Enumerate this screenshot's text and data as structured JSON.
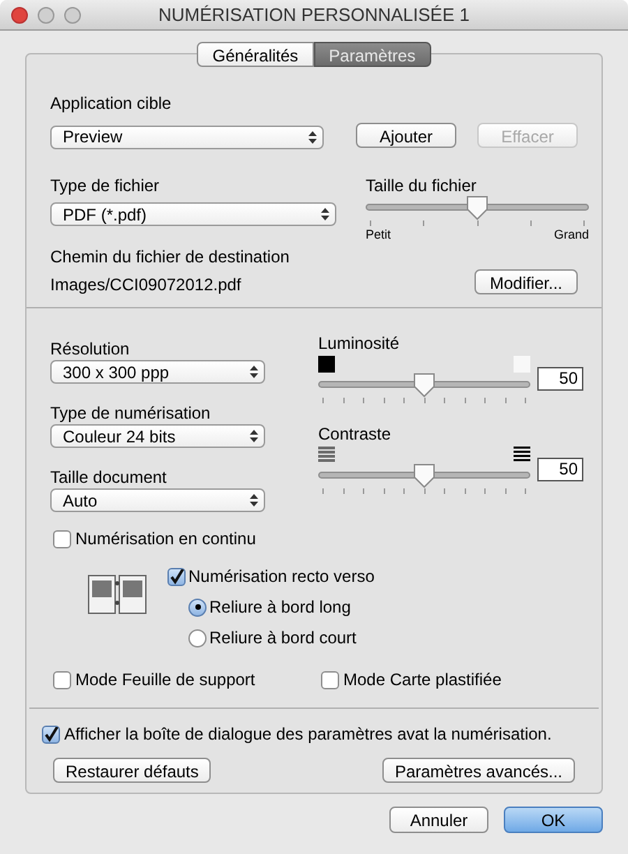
{
  "window": {
    "title": "NUMÉRISATION PERSONNALISÉE 1"
  },
  "tabs": [
    {
      "label": "Généralités",
      "selected": false
    },
    {
      "label": "Paramètres",
      "selected": true
    }
  ],
  "target_app": {
    "label": "Application cible",
    "value": "Preview"
  },
  "target_buttons": [
    {
      "label": "Ajouter",
      "disabled": false
    },
    {
      "label": "Effacer",
      "disabled": true
    }
  ],
  "file_type": {
    "label": "Type de fichier",
    "value": "PDF (*.pdf)"
  },
  "file_size": {
    "label": "Taille du fichier",
    "level": 0.5,
    "min_label": "Petit",
    "max_label": "Grand"
  },
  "destination": {
    "label": "Chemin du fichier de destination",
    "path": "Images/CCI09072012.pdf",
    "button": "Modifier..."
  },
  "selects": [
    {
      "label": "Résolution",
      "value": "300 x 300 ppp"
    },
    {
      "label": "Type de numérisation",
      "value": "Couleur 24 bits"
    },
    {
      "label": "Taille document",
      "value": "Auto"
    }
  ],
  "adjusters": [
    {
      "kind": "brightness",
      "label": "Luminosité",
      "level": 0.5,
      "value": "50"
    },
    {
      "kind": "contrast",
      "label": "Contraste",
      "level": 0.5,
      "value": "50"
    }
  ],
  "continuous": {
    "label": "Numérisation en continu",
    "checked": false
  },
  "duplex": {
    "label": "Numérisation recto verso",
    "checked": true,
    "options": [
      {
        "label": "Reliure à bord long",
        "selected": true
      },
      {
        "label": "Reliure à bord court",
        "selected": false
      }
    ]
  },
  "modes": [
    {
      "label": "Mode Feuille de support",
      "checked": false
    },
    {
      "label": "Mode Carte plastifiée",
      "checked": false
    }
  ],
  "show_dialog": {
    "label": "Afficher la boîte de dialogue des paramètres avat la numérisation.",
    "checked": true
  },
  "panel_buttons": [
    "Restaurer défauts",
    "Paramètres avancés..."
  ],
  "dialog_buttons": [
    {
      "label": "Annuler",
      "default": false
    },
    {
      "label": "OK",
      "default": true
    }
  ]
}
